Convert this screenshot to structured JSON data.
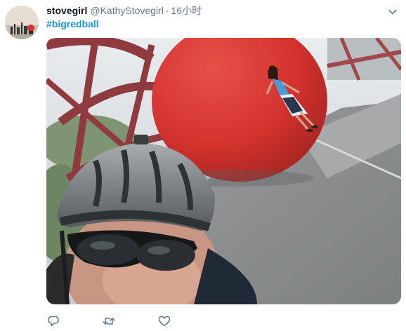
{
  "tweet": {
    "display_name": "stovegirl",
    "handle": "@KathyStovegirl",
    "separator": "·",
    "time": "16小时",
    "hashtag": "#bigredball"
  },
  "icons": {
    "caret": "chevron-down-icon",
    "reply": "reply-icon",
    "retweet": "retweet-icon",
    "like": "heart-icon"
  },
  "colors": {
    "link": "#1b95e0",
    "secondary_text": "#657786",
    "ball": "#d3322d"
  }
}
